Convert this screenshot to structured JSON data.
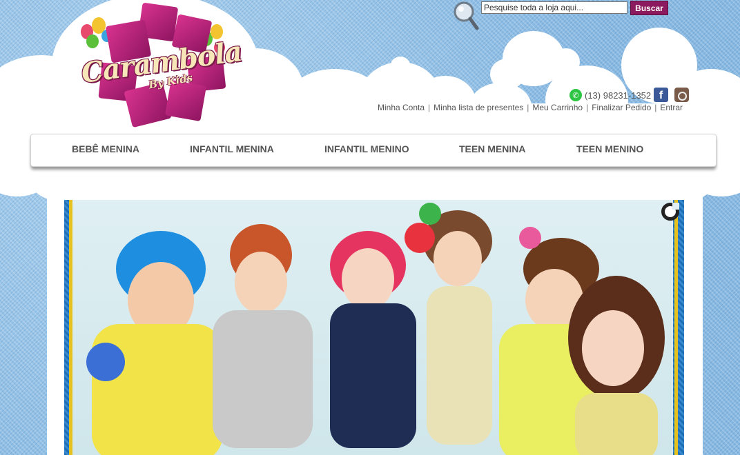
{
  "brand": {
    "name": "Carambola",
    "tagline": "By Kids"
  },
  "search": {
    "placeholder": "Pesquise toda a loja aqui...",
    "button_label": "Buscar"
  },
  "contact": {
    "phone": "(13) 98231-1352",
    "facebook_glyph": "f"
  },
  "account_links": [
    {
      "label": "Minha Conta"
    },
    {
      "label": "Minha lista de presentes"
    },
    {
      "label": "Meu Carrinho"
    },
    {
      "label": "Finalizar Pedido"
    },
    {
      "label": "Entrar"
    }
  ],
  "separator": "|",
  "nav": [
    {
      "label": "BEBÊ MENINA"
    },
    {
      "label": "INFANTIL MENINA"
    },
    {
      "label": "INFANTIL MENINO"
    },
    {
      "label": "TEEN MENINA"
    },
    {
      "label": "TEEN MENINO"
    }
  ],
  "colors": {
    "brand_magenta": "#8c1a5e",
    "denim_blue": "#8fbfe6",
    "nav_text": "#555555"
  },
  "icons": {
    "search": "magnifier-icon",
    "whatsapp": "whatsapp-icon",
    "facebook": "facebook-icon",
    "instagram": "instagram-icon",
    "slider_loader": "loader-icon"
  }
}
